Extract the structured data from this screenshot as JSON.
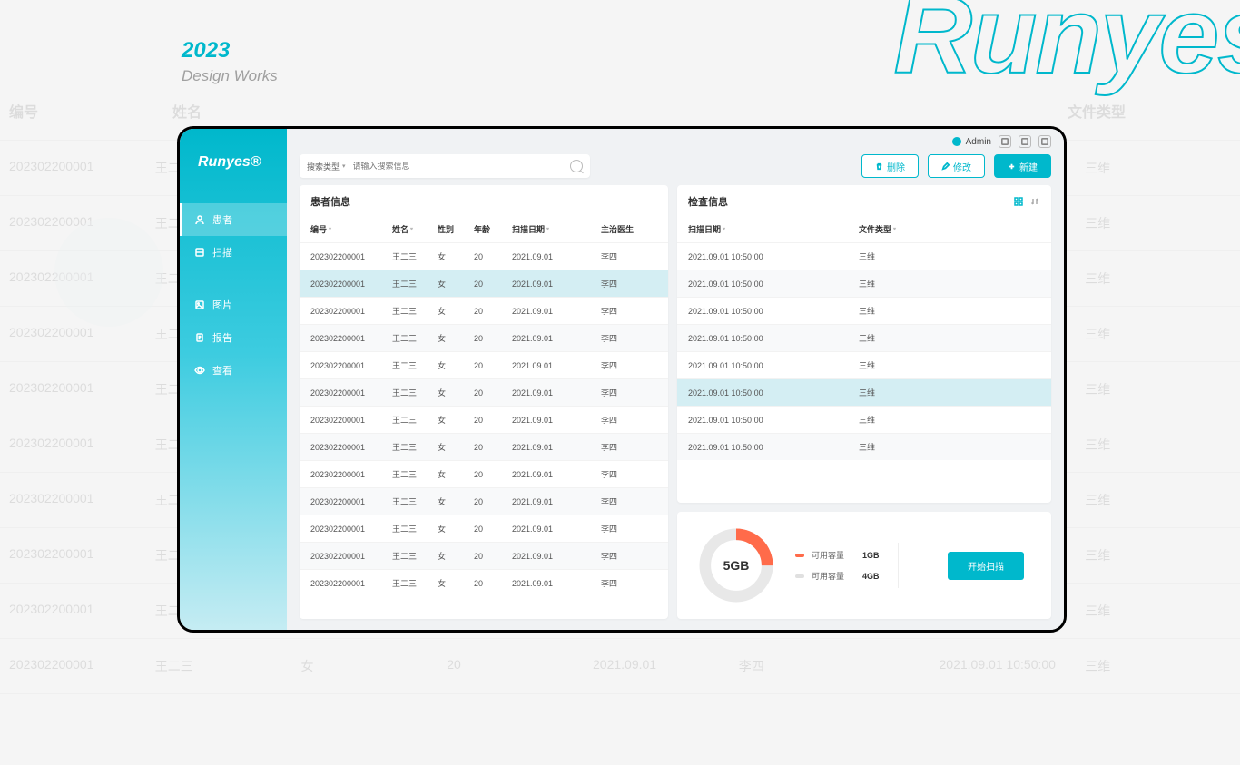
{
  "bg": {
    "year": "2023",
    "works": "Design Works",
    "runyes": "Runyes",
    "search_type": "搜索类型",
    "panel_title": "者信息",
    "new_btn": "新建",
    "cols": {
      "id": "编号",
      "name": "姓名",
      "gender": "性别",
      "age": "年龄",
      "date": "扫描日期",
      "doctor": "主治医生",
      "filetype": "文件类型"
    },
    "row": {
      "id": "202302200001",
      "name": "王二三",
      "gender": "女",
      "age": "20",
      "date": "2021.09.01",
      "doctor": "李四",
      "datetime": "2021.09.01 10:50:00",
      "filetype": "三维"
    }
  },
  "logo": "Runyes®",
  "user": "Admin",
  "sidebar": {
    "items": [
      {
        "label": "患者",
        "icon": "user"
      },
      {
        "label": "扫描",
        "icon": "scan"
      },
      {
        "label": "图片",
        "icon": "image"
      },
      {
        "label": "报告",
        "icon": "report"
      },
      {
        "label": "查看",
        "icon": "view"
      }
    ],
    "active": 0
  },
  "toolbar": {
    "search_type": "搜索类型",
    "placeholder": "请输入搜索信息",
    "delete": "删除",
    "modify": "修改",
    "new": "新建"
  },
  "left_panel": {
    "title": "患者信息",
    "cols": {
      "id": "编号",
      "name": "姓名",
      "gender": "性别",
      "age": "年龄",
      "date": "扫描日期",
      "doctor": "主治医生"
    },
    "rows": [
      {
        "id": "202302200001",
        "name": "王二三",
        "gender": "女",
        "age": "20",
        "date": "2021.09.01",
        "doctor": "李四"
      },
      {
        "id": "202302200001",
        "name": "王二三",
        "gender": "女",
        "age": "20",
        "date": "2021.09.01",
        "doctor": "李四"
      },
      {
        "id": "202302200001",
        "name": "王二三",
        "gender": "女",
        "age": "20",
        "date": "2021.09.01",
        "doctor": "李四"
      },
      {
        "id": "202302200001",
        "name": "王二三",
        "gender": "女",
        "age": "20",
        "date": "2021.09.01",
        "doctor": "李四"
      },
      {
        "id": "202302200001",
        "name": "王二三",
        "gender": "女",
        "age": "20",
        "date": "2021.09.01",
        "doctor": "李四"
      },
      {
        "id": "202302200001",
        "name": "王二三",
        "gender": "女",
        "age": "20",
        "date": "2021.09.01",
        "doctor": "李四"
      },
      {
        "id": "202302200001",
        "name": "王二三",
        "gender": "女",
        "age": "20",
        "date": "2021.09.01",
        "doctor": "李四"
      },
      {
        "id": "202302200001",
        "name": "王二三",
        "gender": "女",
        "age": "20",
        "date": "2021.09.01",
        "doctor": "李四"
      },
      {
        "id": "202302200001",
        "name": "王二三",
        "gender": "女",
        "age": "20",
        "date": "2021.09.01",
        "doctor": "李四"
      },
      {
        "id": "202302200001",
        "name": "王二三",
        "gender": "女",
        "age": "20",
        "date": "2021.09.01",
        "doctor": "李四"
      },
      {
        "id": "202302200001",
        "name": "王二三",
        "gender": "女",
        "age": "20",
        "date": "2021.09.01",
        "doctor": "李四"
      },
      {
        "id": "202302200001",
        "name": "王二三",
        "gender": "女",
        "age": "20",
        "date": "2021.09.01",
        "doctor": "李四"
      },
      {
        "id": "202302200001",
        "name": "王二三",
        "gender": "女",
        "age": "20",
        "date": "2021.09.01",
        "doctor": "李四"
      }
    ],
    "selected": 1
  },
  "right_panel": {
    "title": "检查信息",
    "cols": {
      "date": "扫描日期",
      "type": "文件类型"
    },
    "rows": [
      {
        "date": "2021.09.01 10:50:00",
        "type": "三维"
      },
      {
        "date": "2021.09.01 10:50:00",
        "type": "三维"
      },
      {
        "date": "2021.09.01 10:50:00",
        "type": "三维"
      },
      {
        "date": "2021.09.01 10:50:00",
        "type": "三维"
      },
      {
        "date": "2021.09.01 10:50:00",
        "type": "三维"
      },
      {
        "date": "2021.09.01 10:50:00",
        "type": "三维"
      },
      {
        "date": "2021.09.01 10:50:00",
        "type": "三维"
      },
      {
        "date": "2021.09.01 10:50:00",
        "type": "三维"
      }
    ],
    "selected": 5
  },
  "storage": {
    "center": "5GB",
    "items": [
      {
        "label": "可用容量",
        "value": "1GB",
        "color": "#ff6b4a"
      },
      {
        "label": "可用容量",
        "value": "4GB",
        "color": "#e0e0e0"
      }
    ],
    "pct_used": 25,
    "button": "开始扫描"
  },
  "chart_data": {
    "type": "pie",
    "title": "",
    "series": [
      {
        "name": "可用容量",
        "value": 1,
        "unit": "GB"
      },
      {
        "name": "可用容量",
        "value": 4,
        "unit": "GB"
      }
    ],
    "total": {
      "label": "5GB",
      "value": 5
    }
  }
}
